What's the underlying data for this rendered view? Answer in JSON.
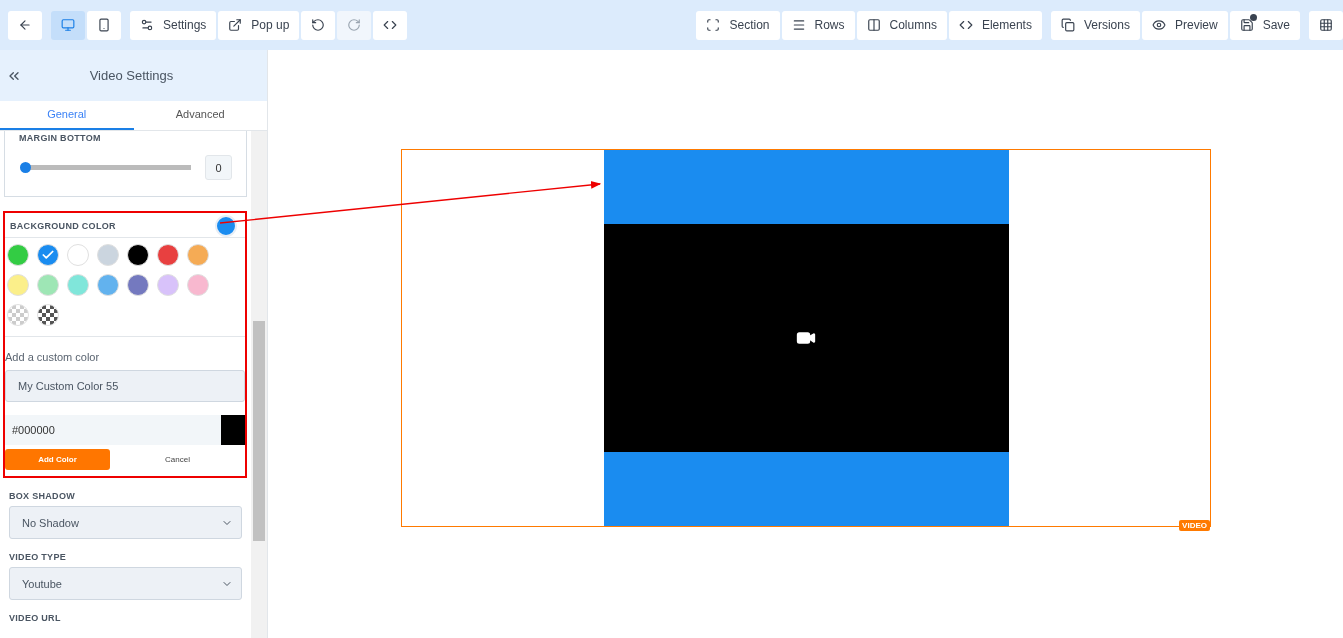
{
  "toolbar": {
    "left": [
      {
        "kind": "back"
      },
      {
        "kind": "desktop",
        "selected": true
      },
      {
        "kind": "mobile",
        "selected": false
      },
      {
        "kind": "settings",
        "label": "Settings"
      },
      {
        "kind": "popup",
        "label": "Pop up"
      },
      {
        "kind": "undo",
        "disabled": false
      },
      {
        "kind": "redo",
        "disabled": true
      },
      {
        "kind": "code"
      }
    ],
    "right": [
      {
        "kind": "section",
        "label": "Section"
      },
      {
        "kind": "rows",
        "label": "Rows"
      },
      {
        "kind": "columns",
        "label": "Columns"
      },
      {
        "kind": "code",
        "label": "Elements"
      },
      {
        "kind": "versions",
        "label": "Versions"
      },
      {
        "kind": "preview",
        "label": "Preview"
      },
      {
        "kind": "save",
        "label": "Save"
      },
      {
        "kind": "grid"
      }
    ]
  },
  "panel": {
    "title": "Video Settings",
    "tabs": [
      {
        "label": "General",
        "selected": true
      },
      {
        "label": "Advanced",
        "selected": false
      }
    ],
    "margin_bottom": {
      "label": "MARGIN BOTTOM",
      "level": 0,
      "value": "0"
    },
    "background_color": {
      "label": "BACKGROUND COLOR",
      "swatches": [
        {
          "kind": "solid",
          "color": "#33cc44",
          "selected": false
        },
        {
          "kind": "solid",
          "color": "#1a8cf0",
          "selected": true
        },
        {
          "kind": "solid",
          "color": "#ffffff",
          "selected": false
        },
        {
          "kind": "solid",
          "color": "#cbd5df",
          "selected": false
        },
        {
          "kind": "solid",
          "color": "#000000",
          "selected": false
        },
        {
          "kind": "solid",
          "color": "#e84040",
          "selected": false
        },
        {
          "kind": "solid",
          "color": "#f5ab55",
          "selected": false
        },
        {
          "kind": "solid",
          "color": "#fbef8a",
          "selected": false
        },
        {
          "kind": "solid",
          "color": "#9ee6b5",
          "selected": false
        },
        {
          "kind": "solid",
          "color": "#80e6da",
          "selected": false
        },
        {
          "kind": "solid",
          "color": "#62b2ee",
          "selected": false
        },
        {
          "kind": "solid",
          "color": "#7479bf",
          "selected": false
        },
        {
          "kind": "solid",
          "color": "#d8c2fa",
          "selected": false
        },
        {
          "kind": "solid",
          "color": "#f8b8cf",
          "selected": false
        },
        {
          "kind": "checker",
          "color": "#cccccc",
          "selected": false
        },
        {
          "kind": "checker",
          "color": "#555555",
          "selected": false
        }
      ],
      "custom_label": "Add a custom color",
      "name_value": "My Custom Color 55",
      "hex_value": "#000000",
      "add_button": "Add Color",
      "cancel_button": "Cancel"
    },
    "box_shadow": {
      "label": "BOX SHADOW",
      "value": "No Shadow"
    },
    "video_type": {
      "label": "VIDEO TYPE",
      "value": "Youtube"
    },
    "video_url": {
      "label": "VIDEO URL"
    }
  },
  "canvas": {
    "element_tag": "VIDEO"
  }
}
